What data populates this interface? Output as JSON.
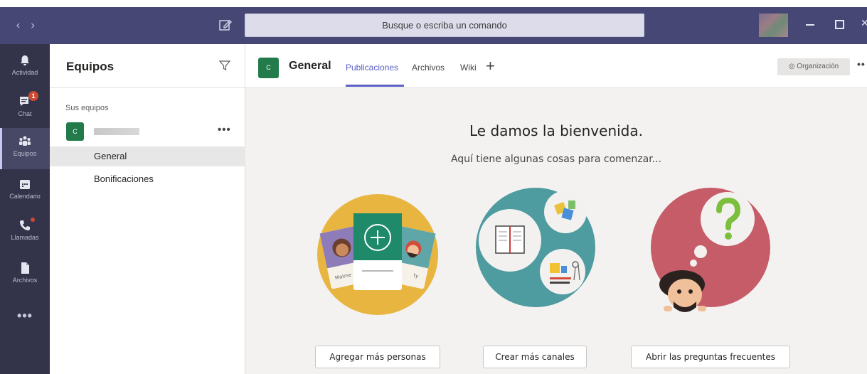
{
  "titlebar": {
    "search_placeholder": "Busque o escriba un comando"
  },
  "rail": {
    "items": [
      {
        "label": "Actividad",
        "icon": "bell-icon"
      },
      {
        "label": "Chat",
        "icon": "chat-icon",
        "badge": "1"
      },
      {
        "label": "Equipos",
        "icon": "teams-icon"
      },
      {
        "label": "Calendario",
        "icon": "calendar-icon"
      },
      {
        "label": "Llamadas",
        "icon": "phone-icon"
      },
      {
        "label": "Archivos",
        "icon": "files-icon"
      }
    ],
    "more": "•••"
  },
  "teams_panel": {
    "title": "Equipos",
    "section": "Sus equipos",
    "team_avatar_letter": "C",
    "team_more": "•••",
    "channels": [
      "General",
      "Bonificaciones"
    ]
  },
  "main": {
    "channel_avatar_letter": "C",
    "channel_title": "General",
    "tabs": [
      "Publicaciones",
      "Archivos",
      "Wiki"
    ],
    "org_button": "Organización",
    "welcome_title": "Le damos la bienvenida.",
    "welcome_subtitle": "Aquí tiene algunas cosas para comenzar...",
    "actions": [
      "Agregar más personas",
      "Crear más canales",
      "Abrir las preguntas frecuentes"
    ],
    "card_names": [
      "Maime",
      "ty"
    ]
  },
  "colors": {
    "titlebar": "#464775",
    "rail": "#33344a",
    "accent": "#5b5fc7",
    "team_green": "#237b4b"
  }
}
